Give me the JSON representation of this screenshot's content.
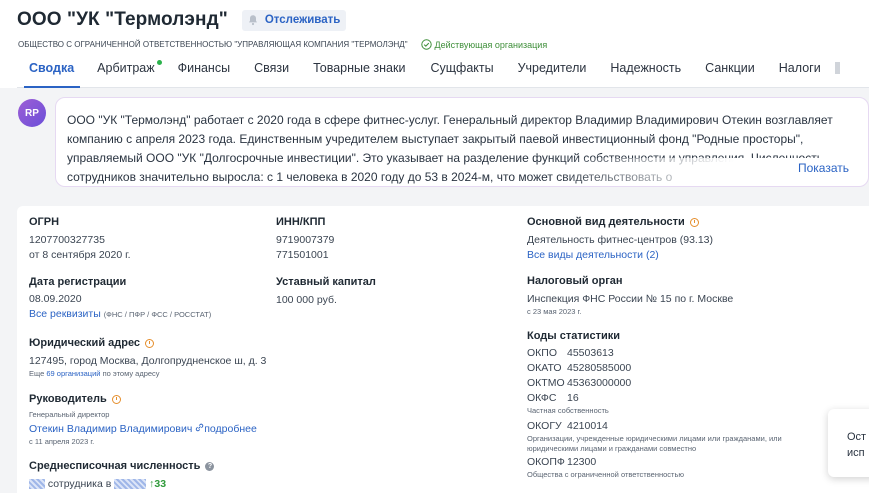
{
  "header": {
    "company_title": "ООО \"УК \"Термолэнд\"",
    "track_label": "Отслеживать",
    "full_name": "ОБЩЕСТВО С ОГРАНИЧЕННОЙ ОТВЕТСТВЕННОСТЬЮ \"УПРАВЛЯЮЩАЯ КОМПАНИЯ \"ТЕРМОЛЭНД\"",
    "status": "Действующая организация",
    "status_color": "#3f8f3a"
  },
  "tabs": [
    {
      "label": "Сводка",
      "active": true
    },
    {
      "label": "Арбитраж",
      "dot": true
    },
    {
      "label": "Финансы"
    },
    {
      "label": "Связи"
    },
    {
      "label": "Товарные знаки"
    },
    {
      "label": "Сущфакты"
    },
    {
      "label": "Учредители"
    },
    {
      "label": "Надежность"
    },
    {
      "label": "Санкции"
    },
    {
      "label": "Налоги"
    }
  ],
  "summary": {
    "avatar": "RP",
    "text": "ООО \"УК \"Термолэнд\" работает с 2020 года в сфере фитнес-услуг. Генеральный директор Владимир Владимирович Отекин возглавляет компанию с апреля 2023 года. Единственным учредителем выступает закрытый паевой инвестиционный фонд \"Родные просторы\", управляемый ООО \"УК \"Долгосрочные инвестиции\". Это указывает на разделение функций собственности и управления. Численность сотрудников значительно выросла: с 1 человека в 2020 году до 53 в 2024-м, что может свидетельствовать о",
    "show_more": "Показать"
  },
  "details": {
    "ogrn": {
      "label": "ОГРН",
      "value": "1207700327735",
      "date": "от 8 сентября 2020 г."
    },
    "reg": {
      "label": "Дата регистрации",
      "value": "08.09.2020",
      "link": "Все реквизиты",
      "note": "(ФНС / ПФР / ФСС / РОССТАТ)"
    },
    "address": {
      "label": "Юридический адрес",
      "value": "127495, город Москва, Долгопрудненское ш, д. 3",
      "note_prefix": "Еще",
      "note_link": "69 организаций",
      "note_suffix": "по этому адресу"
    },
    "head": {
      "label": "Руководитель",
      "role": "Генеральный директор",
      "name": "Отекин Владимир Владимирович",
      "more": "подробнее",
      "since": "с 11 апреля 2023 г."
    },
    "staff": {
      "label": "Среднесписочная численность",
      "text1": "сотрудника в",
      "delta": "↑33"
    },
    "inn": {
      "label": "ИНН/КПП",
      "inn": "9719007379",
      "kpp": "771501001"
    },
    "capital": {
      "label": "Уставный капитал",
      "value": "100 000 руб."
    },
    "activity": {
      "label": "Основной вид деятельности",
      "value": "Деятельность фитнес-центров",
      "code": "(93.13)",
      "all_link": "Все виды деятельности (2)"
    },
    "tax": {
      "label": "Налоговый орган",
      "value": "Инспекция ФНС России № 15 по г. Москве",
      "since": "с 23 мая 2023 г."
    },
    "stats": {
      "label": "Коды статистики",
      "okpo_k": "ОКПО",
      "okpo_v": "45503613",
      "okato_k": "ОКАТО",
      "okato_v": "45280585000",
      "oktmo_k": "ОКТМО",
      "oktmo_v": "45363000000",
      "okfs_k": "ОКФС",
      "okfs_v": "16",
      "okfs_note": "Частная собственность",
      "okogu_k": "ОКОГУ",
      "okogu_v": "4210014",
      "okogu_note": "Организации, учрежденные юридическими лицами или гражданами, или юридическими лицами и гражданами совместно",
      "okopf_k": "ОКОПФ",
      "okopf_v": "12300",
      "okopf_note": "Общества с ограниченной ответственностью"
    }
  },
  "toast": {
    "line1": "Ост",
    "line2": "исп"
  }
}
